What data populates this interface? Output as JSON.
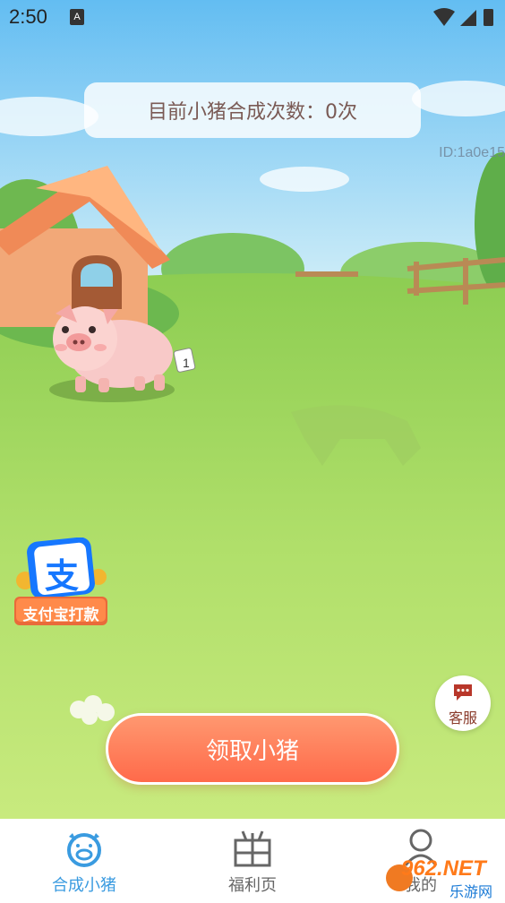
{
  "status_bar": {
    "time": "2:50",
    "notification_glyph": "A"
  },
  "counter": {
    "text": "目前小猪合成次数：0次"
  },
  "user": {
    "id_text": "ID:1a0e15"
  },
  "pig": {
    "level": "1"
  },
  "promo": {
    "icon_char": "支",
    "label": "支付宝打款"
  },
  "customer_service": {
    "label": "客服"
  },
  "claim_button": {
    "label": "领取小猪"
  },
  "tabs": [
    {
      "label": "合成小猪",
      "icon": "pig-face-icon",
      "active": true
    },
    {
      "label": "福利页",
      "icon": "gift-grid-icon",
      "active": false
    },
    {
      "label": "我的",
      "icon": "person-icon",
      "active": false
    }
  ],
  "watermark": {
    "brand": "962.NET",
    "sub": "乐游网"
  },
  "colors": {
    "active_tab": "#3a9be0",
    "inactive_tab": "#666666",
    "button": "#ff7a55",
    "grass": "#a9dc62"
  }
}
